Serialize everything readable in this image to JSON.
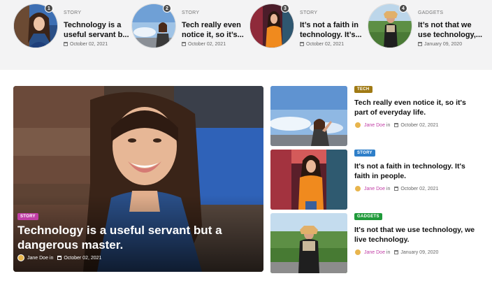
{
  "strip": [
    {
      "num": "1",
      "category": "STORY",
      "title": "Technology is a useful servant b...",
      "date": "October 02, 2021"
    },
    {
      "num": "2",
      "category": "STORY",
      "title": "Tech really even notice it, so it’s...",
      "date": "October 02, 2021"
    },
    {
      "num": "3",
      "category": "STORY",
      "title": "It’s not a faith in technology. It’s...",
      "date": "October 02, 2021"
    },
    {
      "num": "4",
      "category": "GADGETS",
      "title": "It’s not that we use technology,...",
      "date": "January 09, 2020"
    }
  ],
  "hero": {
    "category": "STORY",
    "title": "Technology is a useful servant but a dangerous master.",
    "author": "Jane Doe",
    "in_word": "in",
    "date": "October 02, 2021"
  },
  "side": [
    {
      "category": "TECH",
      "title": "Tech really even notice it, so it's part of everyday life.",
      "author": "Jane Doe",
      "in_word": "in",
      "date": "October 02, 2021"
    },
    {
      "category": "STORY",
      "title": "It's not a faith in technology. It's faith in people.",
      "author": "Jane Doe",
      "in_word": "in",
      "date": "October 02, 2021"
    },
    {
      "category": "GADGETS",
      "title": "It's not that we use technology, we live technology.",
      "author": "Jane Doe",
      "in_word": "in",
      "date": "January 09, 2020"
    }
  ],
  "colors": {
    "story": "#c13fa6",
    "tech": "#a07a14",
    "story_blue": "#2e7fc9",
    "gadgets": "#1f9a3a",
    "author": "#c13fa6"
  },
  "icons": {
    "date": "calendar-icon",
    "author": "avatar-icon"
  }
}
